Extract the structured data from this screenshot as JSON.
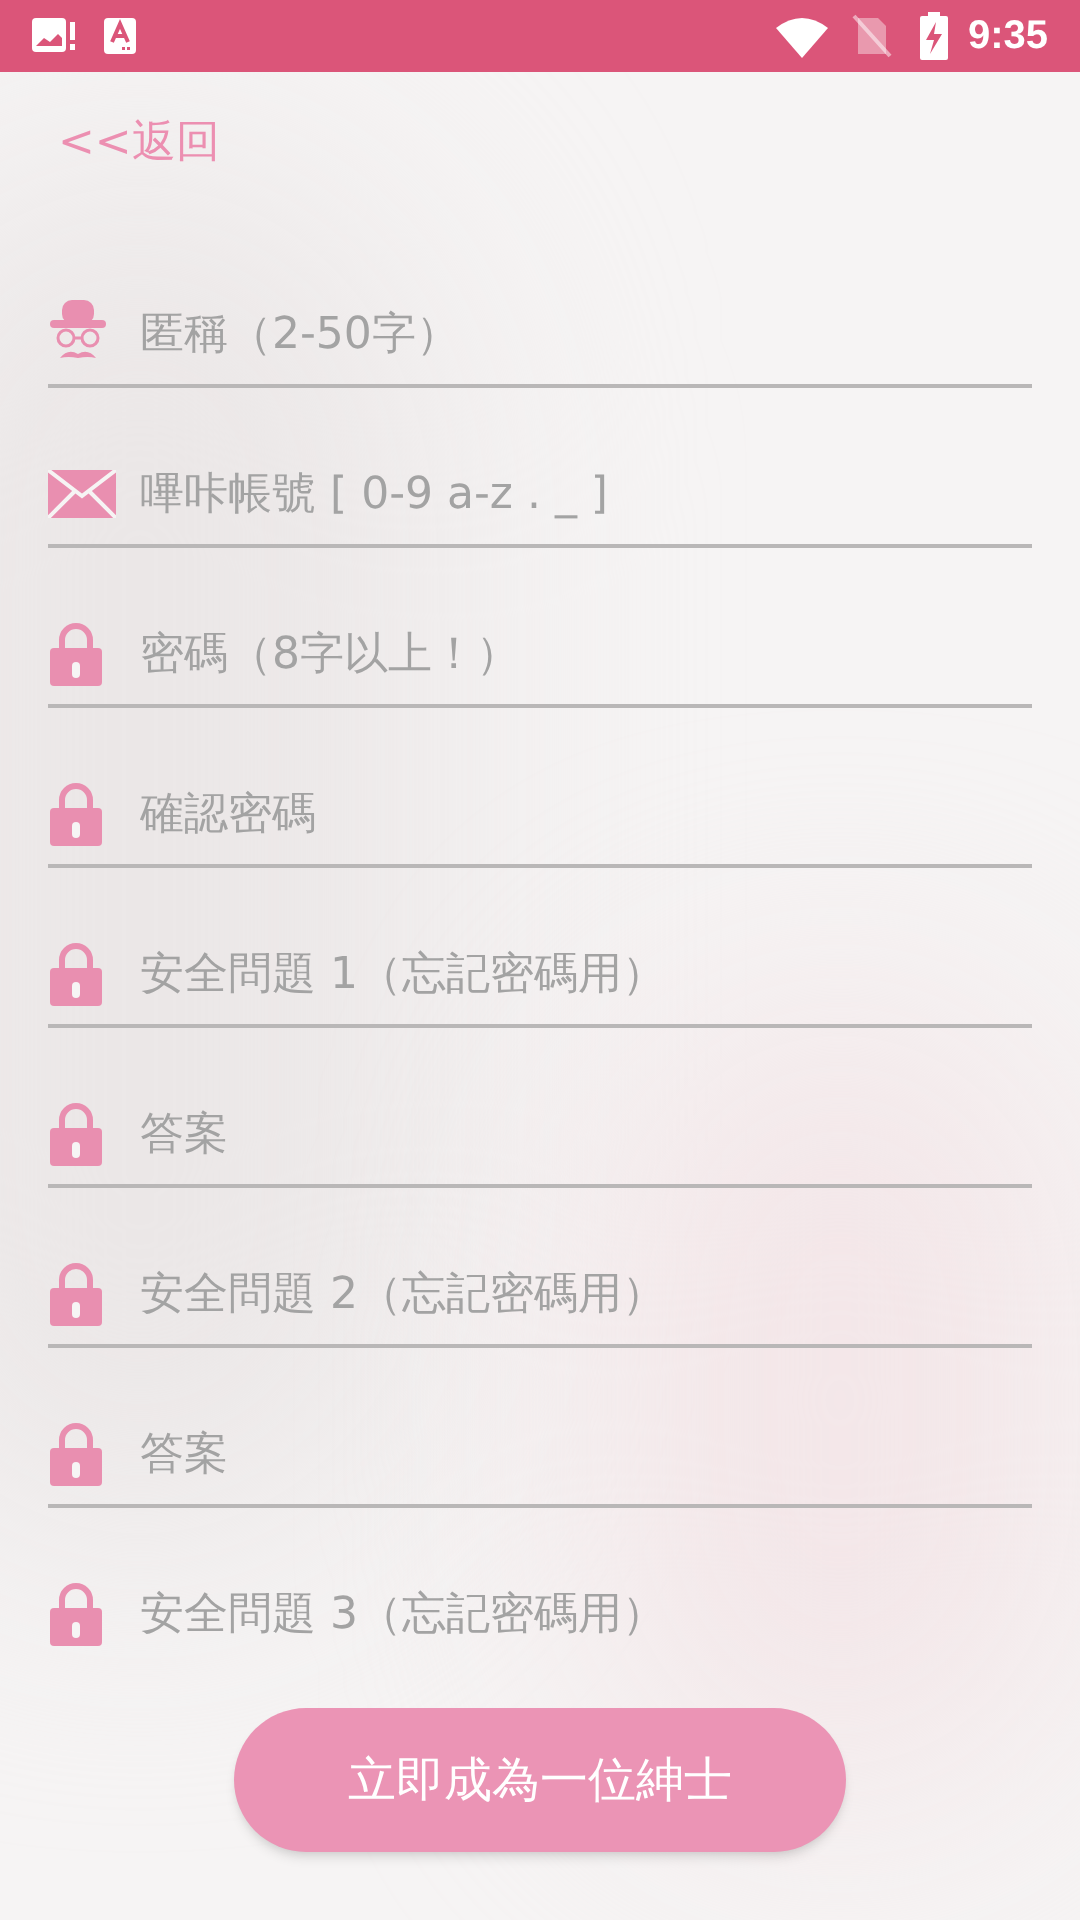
{
  "status_bar": {
    "time": "9:35"
  },
  "back_link": "<<返回",
  "fields": [
    {
      "kind": "hat",
      "placeholder": "匿稱（2-50字）"
    },
    {
      "kind": "mail",
      "placeholder": "嗶咔帳號 [ 0-9 a-z . _ ]"
    },
    {
      "kind": "lock",
      "placeholder": "密碼（8字以上！）"
    },
    {
      "kind": "lock",
      "placeholder": "確認密碼"
    },
    {
      "kind": "lock",
      "placeholder": "安全問題 1（忘記密碼用）"
    },
    {
      "kind": "lock",
      "placeholder": "答案"
    },
    {
      "kind": "lock",
      "placeholder": "安全問題 2（忘記密碼用）"
    },
    {
      "kind": "lock",
      "placeholder": "答案"
    },
    {
      "kind": "lock",
      "placeholder": "安全問題 3（忘記密碼用）"
    }
  ],
  "submit_button": "立即成為一位紳士"
}
